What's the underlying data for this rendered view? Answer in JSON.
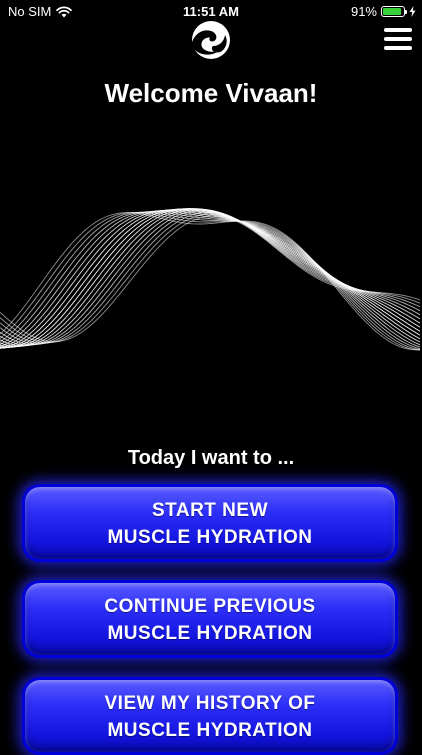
{
  "status_bar": {
    "carrier": "No SIM",
    "time": "11:51 AM",
    "battery_text": "91%",
    "battery_level": 0.91,
    "battery_color": "#3ad23a",
    "signal_icon": "wifi-icon",
    "charging_icon": "bolt-icon"
  },
  "header": {
    "logo_icon": "wave-logo-icon",
    "menu_icon": "hamburger-menu-icon",
    "welcome_text": "Welcome Vivaan!"
  },
  "main": {
    "prompt": "Today I want to ...",
    "buttons": [
      {
        "line1": "START NEW",
        "line2": "MUSCLE HYDRATION"
      },
      {
        "line1": "CONTINUE PREVIOUS",
        "line2": "MUSCLE HYDRATION"
      },
      {
        "line1": "VIEW MY HISTORY OF",
        "line2": "MUSCLE HYDRATION"
      }
    ]
  },
  "colors": {
    "background": "#000000",
    "button_blue": "#2d2ff8",
    "text": "#ffffff"
  }
}
